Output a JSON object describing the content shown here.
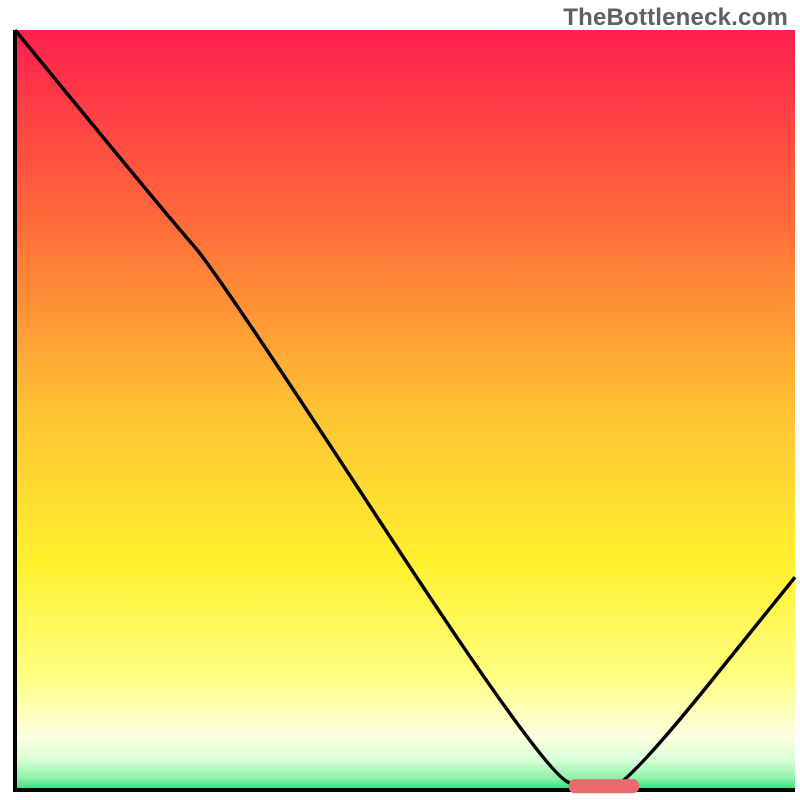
{
  "watermark": "TheBottleneck.com",
  "chart_data": {
    "type": "line",
    "title": "",
    "xlabel": "",
    "ylabel": "",
    "xlim": [
      0,
      100
    ],
    "ylim": [
      0,
      100
    ],
    "curve": [
      {
        "x": 0,
        "y": 100
      },
      {
        "x": 20,
        "y": 75
      },
      {
        "x": 26,
        "y": 68
      },
      {
        "x": 68,
        "y": 2
      },
      {
        "x": 74,
        "y": 0
      },
      {
        "x": 78,
        "y": 0
      },
      {
        "x": 100,
        "y": 28
      }
    ],
    "optimal_marker": {
      "x_start": 71,
      "x_end": 80,
      "y": 0.5
    },
    "background_gradient": [
      {
        "offset": 0.0,
        "color": "#ff1f4e"
      },
      {
        "offset": 0.25,
        "color": "#ff6a3a"
      },
      {
        "offset": 0.5,
        "color": "#ffc233"
      },
      {
        "offset": 0.7,
        "color": "#fff02e"
      },
      {
        "offset": 0.85,
        "color": "#ffff80"
      },
      {
        "offset": 0.93,
        "color": "#fbffe0"
      },
      {
        "offset": 0.96,
        "color": "#d8ffd8"
      },
      {
        "offset": 0.985,
        "color": "#8ef0a8"
      },
      {
        "offset": 1.0,
        "color": "#24e07a"
      }
    ],
    "marker_color": "#e86b6b",
    "curve_color": "#000000",
    "axis_color": "#000000"
  }
}
